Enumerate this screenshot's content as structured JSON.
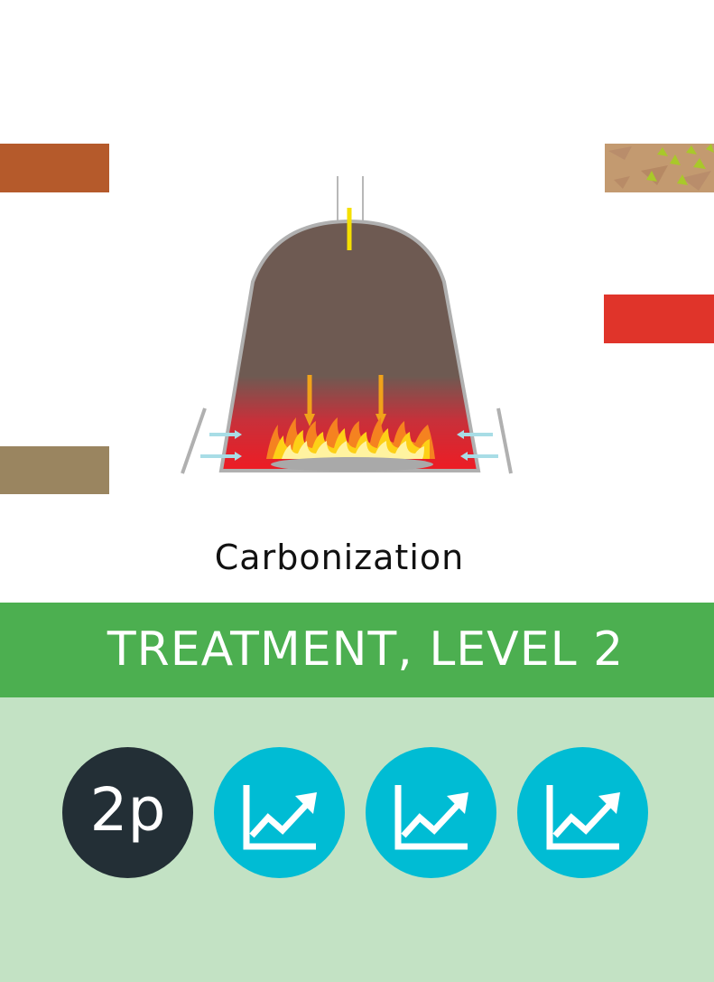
{
  "card": {
    "caption": "Carbonization",
    "level_title": "TREATMENT, LEVEL 2"
  },
  "resource_tiles": [
    {
      "name": "brown-resource-tile",
      "color": "#b55a2b"
    },
    {
      "name": "khaki-resource-tile",
      "color": "#9a8560"
    },
    {
      "name": "red-resource-tile",
      "color": "#e0342a"
    },
    {
      "name": "patterned-resource-tile",
      "color": "#c49a6c"
    }
  ],
  "tokens": {
    "players_label": "2p",
    "growth_icons": [
      "growth-chart-icon",
      "growth-chart-icon",
      "growth-chart-icon"
    ]
  },
  "colors": {
    "banner": "#4caf50",
    "panel": "#c3e2c4",
    "players_token": "#232f36",
    "growth_token": "#00bcd4",
    "kiln_body": "#6e5a52",
    "fire": "#e8282a"
  }
}
